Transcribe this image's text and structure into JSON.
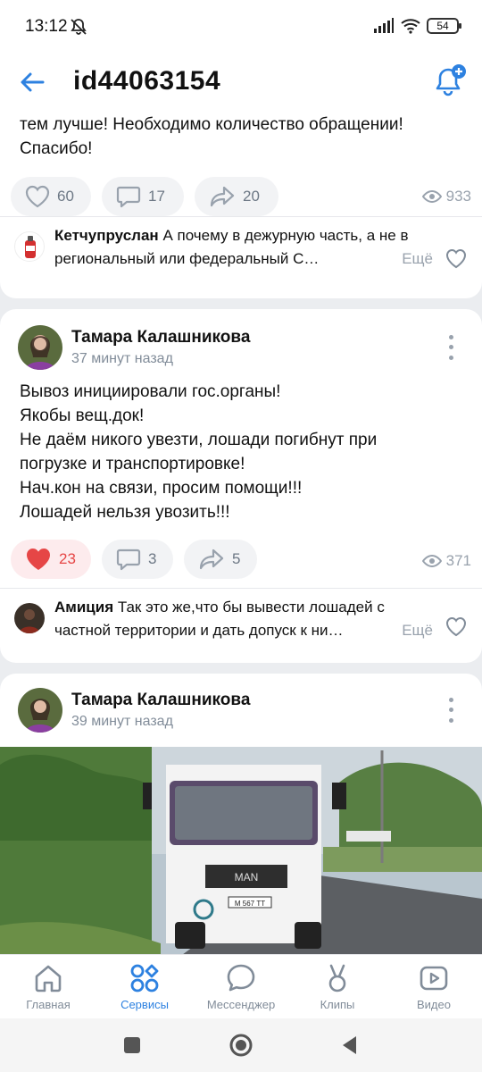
{
  "status_bar": {
    "time": "13:12",
    "battery": "54"
  },
  "header": {
    "title": "id44063154"
  },
  "post1": {
    "text_tail": "тем лучше! Необходимо количество обращении! Спасибо!",
    "likes": "60",
    "comments": "17",
    "shares": "20",
    "views": "933",
    "comment": {
      "author": "Кетчупруслан",
      "text": "А почему в дежурную часть, а не в региональный или федеральный С…",
      "more": "Ещё"
    }
  },
  "post2": {
    "author": "Тамара Калашникова",
    "time": "37 минут назад",
    "lines": [
      "Вывоз инициировали гос.органы!",
      "Якобы вещ.док!",
      "Не даём никого увезти, лошади погибнут при погрузке и транспортировке!",
      "Нач.кон на связи, просим помощи!!!",
      "Лошадей нельзя увозить!!!"
    ],
    "likes": "23",
    "comments": "3",
    "shares": "5",
    "views": "371",
    "comment": {
      "author": "Амиция",
      "text": "Так это же,что бы вывести лошадей с частной территории и дать допуск к ни…",
      "more": "Ещё"
    }
  },
  "post3": {
    "author": "Тамара Калашникова",
    "time": "39 минут назад",
    "image_plate": "M 567 ТТ"
  },
  "tabbar": {
    "tabs": [
      {
        "label": "Главная",
        "icon": "home-icon"
      },
      {
        "label": "Сервисы",
        "icon": "services-icon"
      },
      {
        "label": "Мессенджер",
        "icon": "messenger-icon"
      },
      {
        "label": "Клипы",
        "icon": "clips-icon"
      },
      {
        "label": "Видео",
        "icon": "video-icon"
      }
    ],
    "active": "Сервисы"
  },
  "colors": {
    "accent": "#2d81e0",
    "like_red": "#e64646",
    "muted": "#99a2ad"
  }
}
